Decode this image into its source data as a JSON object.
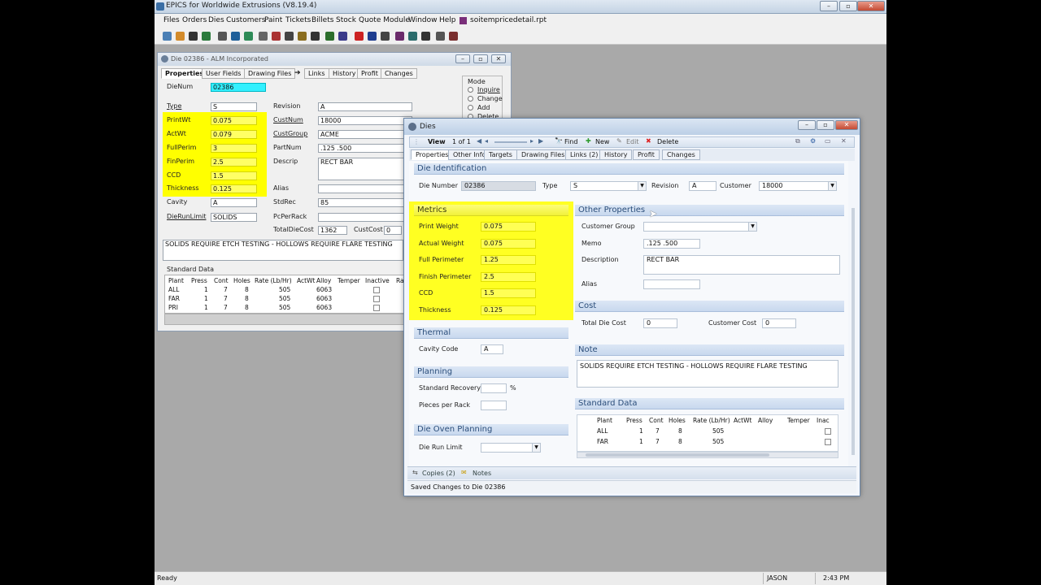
{
  "app": {
    "title": "EPICS for Worldwide Extrusions (V8.19.4)",
    "menu": [
      "Files",
      "Orders",
      "Dies",
      "Customers",
      "Paint",
      "Tickets",
      "Billets",
      "Stock",
      "Quote Module",
      "Window",
      "Help",
      "soitempricedetail.rpt"
    ],
    "status": {
      "ready": "Ready",
      "user": "JASON",
      "time": "2:43 PM"
    }
  },
  "back_window": {
    "title": "Die 02386 - ALM Incorporated",
    "tabs": [
      "Properties",
      "User Fields",
      "Drawing Files",
      "Links",
      "History",
      "Profit",
      "Changes"
    ],
    "mode": {
      "title": "Mode",
      "options": [
        "Inquire",
        "Change",
        "Add",
        "Delete"
      ]
    },
    "fields": {
      "dienum_label": "DieNum",
      "dienum": "02386",
      "type_label": "Type",
      "type": "S",
      "printwt_label": "PrintWt",
      "printwt": "0.075",
      "actwt_label": "ActWt",
      "actwt": "0.079",
      "fullperim_label": "FullPerim",
      "fullperim": "3",
      "finperim_label": "FinPerim",
      "finperim": "2.5",
      "ccd_label": "CCD",
      "ccd": "1.5",
      "thickness_label": "Thickness",
      "thickness": "0.125",
      "cavity_label": "Cavity",
      "cavity": "A",
      "dierunlimit_label": "DieRunLimit",
      "dierunlimit": "SOLIDS",
      "revision_label": "Revision",
      "revision": "A",
      "custnum_label": "CustNum",
      "custnum": "18000",
      "custgroup_label": "CustGroup",
      "custgroup": "ACME",
      "partnum_label": "PartNum",
      "partnum": ".125 .500",
      "descrip_label": "Descrip",
      "descrip": "RECT BAR",
      "alias_label": "Alias",
      "alias": "",
      "stdrec_label": "StdRec",
      "stdrec": "85",
      "pcperrack_label": "PcPerRack",
      "pcperrack": "",
      "totaldiecost_label": "TotalDieCost",
      "totaldiecost": "1362",
      "custcost_label": "CustCost",
      "custcost": "0"
    },
    "note": "SOLIDS REQUIRE ETCH TESTING - HOLLOWS REQUIRE FLARE TESTING",
    "standard_data": {
      "title": "Standard Data",
      "headers": [
        "Plant",
        "Press",
        "Cont",
        "Holes",
        "Rate (Lb/Hr)",
        "ActWt",
        "Alloy",
        "Temper",
        "Inactive",
        "Ra"
      ],
      "rows": [
        [
          "ALL",
          "1",
          "7",
          "8",
          "505",
          "",
          "6063",
          "",
          ""
        ],
        [
          "FAR",
          "1",
          "7",
          "8",
          "505",
          "",
          "6063",
          "",
          ""
        ],
        [
          "PRI",
          "1",
          "7",
          "8",
          "505",
          "",
          "6063",
          "",
          ""
        ]
      ]
    }
  },
  "front_window": {
    "title": "Dies",
    "toolbar": {
      "view": "View",
      "page": "1 of 1",
      "find": "Find",
      "new": "New",
      "edit": "Edit",
      "delete": "Delete"
    },
    "tabs": [
      "Properties",
      "Other Info",
      "Targets",
      "Drawing Files",
      "Links (2)",
      "History",
      "Profit",
      "Changes"
    ],
    "die_identification": {
      "title": "Die Identification",
      "die_number_label": "Die Number",
      "die_number": "02386",
      "type_label": "Type",
      "type": "S",
      "revision_label": "Revision",
      "revision": "A",
      "customer_label": "Customer",
      "customer": "18000"
    },
    "metrics": {
      "title": "Metrics",
      "rows": [
        {
          "label": "Print Weight",
          "value": "0.075"
        },
        {
          "label": "Actual Weight",
          "value": "0.075"
        },
        {
          "label": "Full Perimeter",
          "value": "1.25"
        },
        {
          "label": "Finish Perimeter",
          "value": "2.5"
        },
        {
          "label": "CCD",
          "value": "1.5"
        },
        {
          "label": "Thickness",
          "value": "0.125"
        }
      ]
    },
    "thermal": {
      "title": "Thermal",
      "cavity_code_label": "Cavity Code",
      "cavity_code": "A"
    },
    "planning": {
      "title": "Planning",
      "std_recovery_label": "Standard Recovery",
      "std_recovery": "",
      "pct": "%",
      "pieces_label": "Pieces per Rack",
      "pieces": ""
    },
    "die_oven": {
      "title": "Die Oven Planning",
      "run_limit_label": "Die Run Limit",
      "run_limit": ""
    },
    "other_properties": {
      "title": "Other Properties",
      "customer_group_label": "Customer Group",
      "customer_group": "",
      "memo_label": "Memo",
      "memo": ".125 .500",
      "description_label": "Description",
      "description": "RECT BAR",
      "alias_label": "Alias",
      "alias": ""
    },
    "cost": {
      "title": "Cost",
      "total_label": "Total Die Cost",
      "total": "0",
      "customer_label": "Customer Cost",
      "customer": "0"
    },
    "note": {
      "title": "Note",
      "text": "SOLIDS REQUIRE ETCH TESTING - HOLLOWS REQUIRE FLARE TESTING"
    },
    "standard_data": {
      "title": "Standard Data",
      "headers": [
        "Plant",
        "Press",
        "Cont",
        "Holes",
        "Rate (Lb/Hr)",
        "ActWt",
        "Alloy",
        "Temper",
        "Inac"
      ],
      "rows": [
        [
          "ALL",
          "1",
          "7",
          "8",
          "505"
        ],
        [
          "FAR",
          "1",
          "7",
          "8",
          "505"
        ]
      ]
    },
    "footer": {
      "copies": "Copies (2)",
      "notes": "Notes",
      "status": "Saved Changes to Die 02386"
    }
  }
}
